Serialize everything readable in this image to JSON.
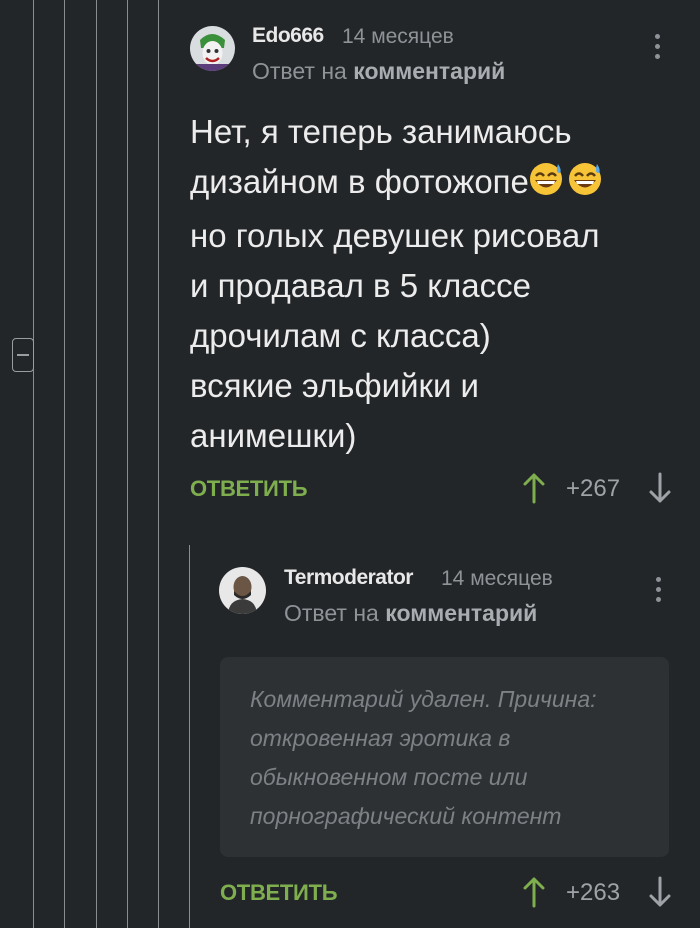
{
  "comments": [
    {
      "author": "Edo666",
      "time": "14 месяцев",
      "reply_prefix": "Ответ на",
      "reply_link": "комментарий",
      "text_lines": [
        "Нет, я теперь занимаюсь",
        "дизайном в фотожопе",
        "но голых девушек рисовал",
        "и продавал в 5 классе",
        "дрочилам с класса)",
        "всякие эльфийки и",
        "анимешки)"
      ],
      "reply_label": "ОТВЕТИТЬ",
      "rating": "+267"
    },
    {
      "author": "Termoderator",
      "time": "14 месяцев",
      "reply_prefix": "Ответ на",
      "reply_link": "комментарий",
      "deleted_lines": [
        "Комментарий удален. Причина:",
        "откровенная эротика в",
        "обыкновенном посте или",
        "порнографический контент"
      ],
      "reply_label": "ОТВЕТИТЬ",
      "rating": "+263"
    }
  ],
  "icons": {
    "more": "vertical-dots-icon",
    "up": "arrow-up-icon",
    "down": "arrow-down-icon",
    "collapse": "minus-icon",
    "emoji": "grinning-sweat-emoji"
  },
  "colors": {
    "background": "#232629",
    "accent_green": "#7fae4e",
    "thread_line": "#8a8d90"
  }
}
